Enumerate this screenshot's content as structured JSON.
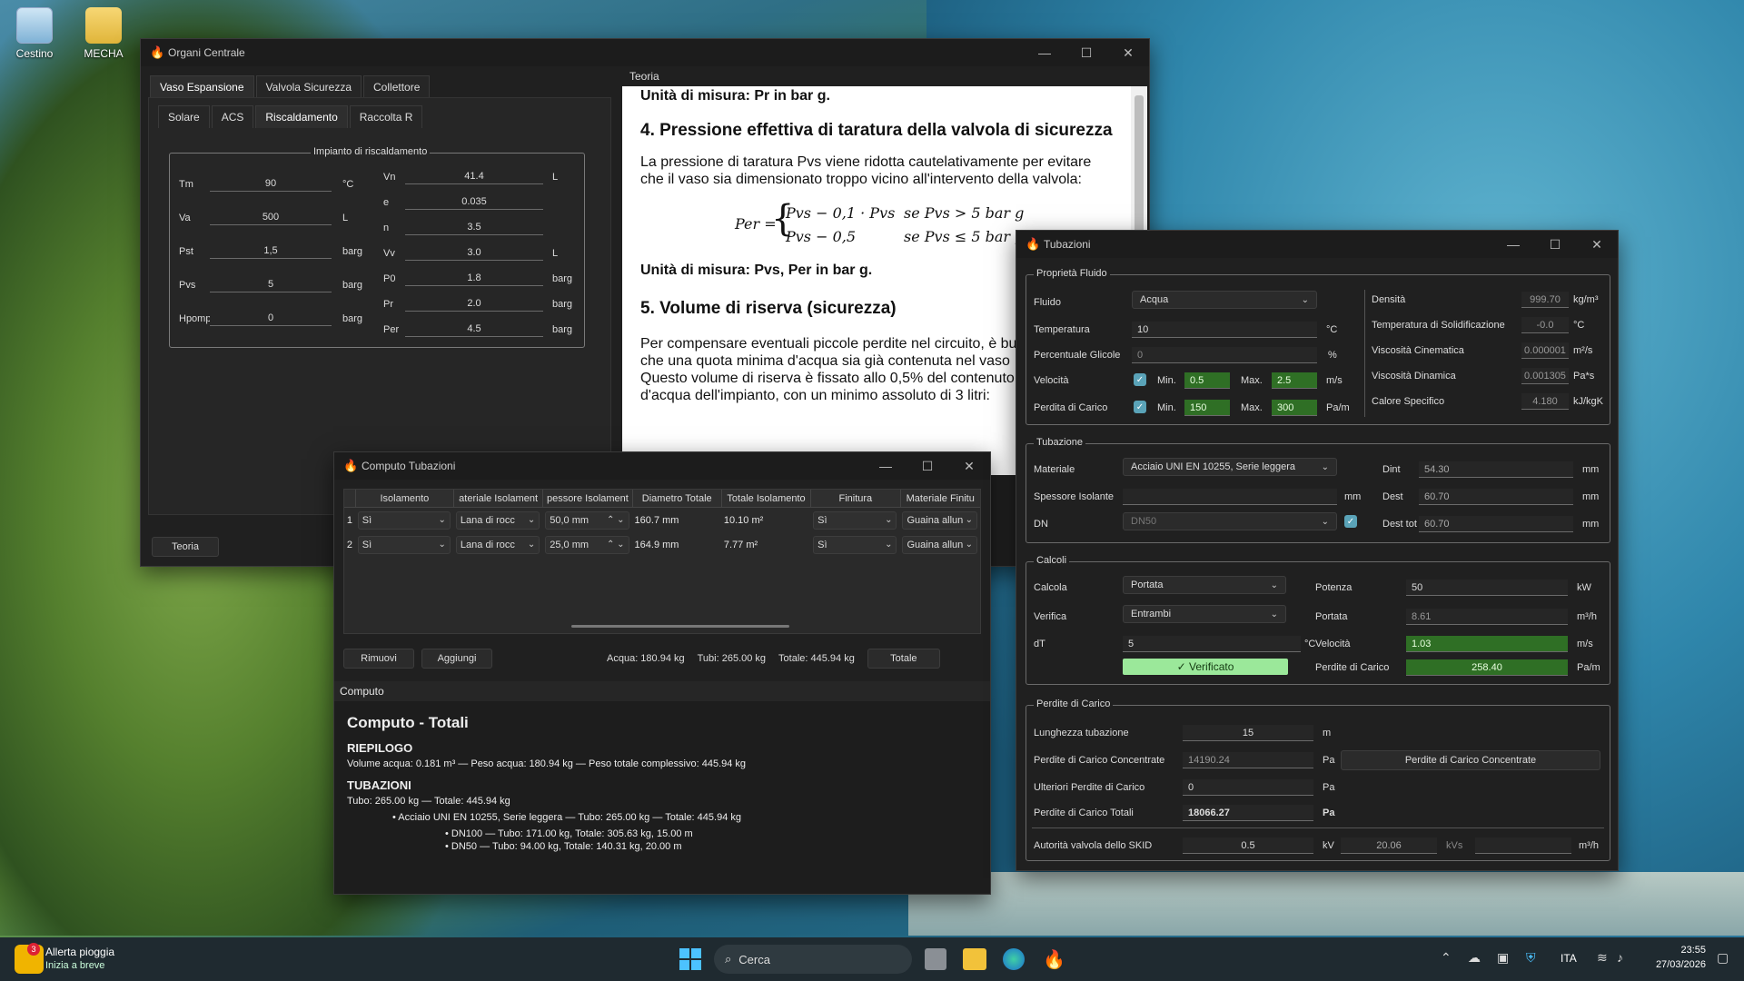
{
  "desktop": {
    "icons": [
      {
        "label": "Cestino"
      },
      {
        "label": "MECHA"
      }
    ]
  },
  "organi": {
    "title": "Organi Centrale",
    "tabs": [
      "Vaso Espansione",
      "Valvola Sicurezza",
      "Collettore"
    ],
    "subtabs": [
      "Solare",
      "ACS",
      "Riscaldamento",
      "Raccolta R"
    ],
    "group": "Impianto di riscaldamento",
    "left": [
      {
        "label": "Tm",
        "value": "90",
        "unit": "°C"
      },
      {
        "label": "Va",
        "value": "500",
        "unit": "L"
      },
      {
        "label": "Pst",
        "value": "1,5",
        "unit": "barg"
      },
      {
        "label": "Pvs",
        "value": "5",
        "unit": "barg"
      },
      {
        "label": "Hpompa",
        "value": "0",
        "unit": "barg"
      }
    ],
    "right": [
      {
        "label": "Vn",
        "value": "41.4",
        "unit": "L"
      },
      {
        "label": "e",
        "value": "0.035",
        "unit": ""
      },
      {
        "label": "n",
        "value": "3.5",
        "unit": ""
      },
      {
        "label": "Vv",
        "value": "3.0",
        "unit": "L"
      },
      {
        "label": "P0",
        "value": "1.8",
        "unit": "barg"
      },
      {
        "label": "Pr",
        "value": "2.0",
        "unit": "barg"
      },
      {
        "label": "Per",
        "value": "4.5",
        "unit": "barg"
      }
    ],
    "teoria_btn": "Teoria"
  },
  "teoria": {
    "title": "Teoria",
    "line0": "Unità di misura: Pr in bar g.",
    "h4": "4. Pressione effettiva di taratura della valvola di sicurezza",
    "p4": "La pressione di taratura Pvs viene ridotta cautelativamente per evitare che il vaso sia dimensionato troppo vicino all'intervento della valvola:",
    "f1": "Pvs − 0,1 · Pvs",
    "f1c": "se Pvs > 5 bar g",
    "f2": "Pvs − 0,5",
    "f2c": "se Pvs ≤ 5 bar g",
    "fl": "Per =",
    "units": "Unità di misura: Pvs, Per in bar g.",
    "h5": "5. Volume di riserva (sicurezza)",
    "p5": "Per compensare eventuali piccole perdite nel circuito, è bu che una quota minima d'acqua sia già contenuta nel vaso Questo volume di riserva è fissato allo 0,5% del contenuto d'acqua dell'impianto, con un minimo assoluto di 3 litri:"
  },
  "computo": {
    "title": "Computo Tubazioni",
    "headers": [
      "Isolamento",
      "ateriale Isolament",
      "pessore Isolament",
      "Diametro Totale",
      "Totale Isolamento",
      "Finitura",
      "Materiale Finitu"
    ],
    "rows": [
      {
        "n": "1",
        "iso": "Sì",
        "mat": "Lana di rocc",
        "sp": "50,0 mm",
        "dt": "160.7 mm",
        "ti": "10.10 m²",
        "fin": "Sì",
        "mf": "Guaina allun"
      },
      {
        "n": "2",
        "iso": "Sì",
        "mat": "Lana di rocc",
        "sp": "25,0 mm",
        "dt": "164.9 mm",
        "ti": "7.77 m²",
        "fin": "Sì",
        "mf": "Guaina allun"
      }
    ],
    "rimuovi": "Rimuovi",
    "aggiungi": "Aggiungi",
    "acqua": "Acqua: 180.94 kg",
    "tubi": "Tubi: 265.00 kg",
    "totale": "Totale: 445.94 kg",
    "totale_btn": "Totale",
    "panel_title": "Computo",
    "heading": "Computo - Totali",
    "riepilogo": "RIEPILOGO",
    "r_line": "Volume acqua: 0.181 m³ — Peso acqua: 180.94 kg — Peso totale complessivo: 445.94 kg",
    "tubazioni": "TUBAZIONI",
    "t_line": "Tubo: 265.00 kg — Totale: 445.94 kg",
    "b1": "• Acciaio UNI EN 10255, Serie leggera — Tubo: 265.00 kg — Totale: 445.94 kg",
    "b2": "• DN100 — Tubo: 171.00 kg, Totale: 305.63 kg, 15.00 m",
    "b3": "• DN50 — Tubo: 94.00 kg, Totale: 140.31 kg, 20.00 m"
  },
  "tubazioni": {
    "title": "Tubazioni",
    "fluido_group": "Proprietà Fluido",
    "fluido_label": "Fluido",
    "fluido": "Acqua",
    "temp_label": "Temperatura",
    "temp": "10",
    "temp_unit": "°C",
    "glic_label": "Percentuale Glicole",
    "glic": "0",
    "glic_unit": "%",
    "vel_label": "Velocità",
    "vel_min": "0.5",
    "vel_max": "2.5",
    "vel_unit": "m/s",
    "pdc_label": "Perdita di Carico",
    "pdc_min": "150",
    "pdc_max": "300",
    "pdc_unit": "Pa/m",
    "min": "Min.",
    "max": "Max.",
    "dens_label": "Densità",
    "dens": "999.70",
    "dens_unit": "kg/m³",
    "sol_label": "Temperatura di Solidificazione",
    "sol": "-0.0",
    "sol_unit": "°C",
    "vc_label": "Viscosità Cinematica",
    "vc": "0.000001",
    "vc_unit": "m²/s",
    "vd_label": "Viscosità Dinamica",
    "vd": "0.001305",
    "vd_unit": "Pa*s",
    "cs_label": "Calore Specifico",
    "cs": "4.180",
    "cs_unit": "kJ/kgK",
    "tub_group": "Tubazione",
    "mat_label": "Materiale",
    "mat": "Acciaio UNI EN 10255, Serie leggera",
    "sp_label": "Spessore Isolante",
    "sp": "",
    "sp_unit": "mm",
    "dn_label": "DN",
    "dn": "DN50",
    "dint_label": "Dint",
    "dint": "54.30",
    "dext_label": "Dest",
    "dext": "60.70",
    "dtot_label": "Dest tot",
    "dtot": "60.70",
    "mm": "mm",
    "calc_group": "Calcoli",
    "calcola_label": "Calcola",
    "calcola": "Portata",
    "verifica_label": "Verifica",
    "verifica": "Entrambi",
    "dt_label": "dT",
    "dt": "5",
    "dt_unit": "°C",
    "verificato": "✓ Verificato",
    "pot_label": "Potenza",
    "pot": "50",
    "pot_unit": "kW",
    "port_label": "Portata",
    "port": "8.61",
    "port_unit": "m³/h",
    "v_label": "Velocità",
    "v": "1.03",
    "v_unit": "m/s",
    "pc_label": "Perdite di Carico",
    "pc": "258.40",
    "pc_unit": "Pa/m",
    "perd_group": "Perdite di Carico",
    "lung_label": "Lunghezza tubazione",
    "lung": "15",
    "lung_unit": "m",
    "conc_label": "Perdite di Carico Concentrate",
    "conc": "14190.24",
    "conc_unit": "Pa",
    "conc_btn": "Perdite di Carico Concentrate",
    "ult_label": "Ulteriori Perdite di Carico",
    "ult": "0",
    "ult_unit": "Pa",
    "tot_label": "Perdite di Carico Totali",
    "tot": "18066.27",
    "tot_unit": "Pa",
    "skid_label": "Autorità valvola dello SKID",
    "skid": "0.5",
    "skid_unit": "kV",
    "kvs": "20.06",
    "kvs_unit": "kVs",
    "m3h": "m³/h"
  },
  "taskbar": {
    "weather_title": "Allerta pioggia",
    "weather_sub": "Inizia a breve",
    "search": "Cerca",
    "lang": "ITA",
    "time": "23:55",
    "date": "27/03/2026"
  }
}
